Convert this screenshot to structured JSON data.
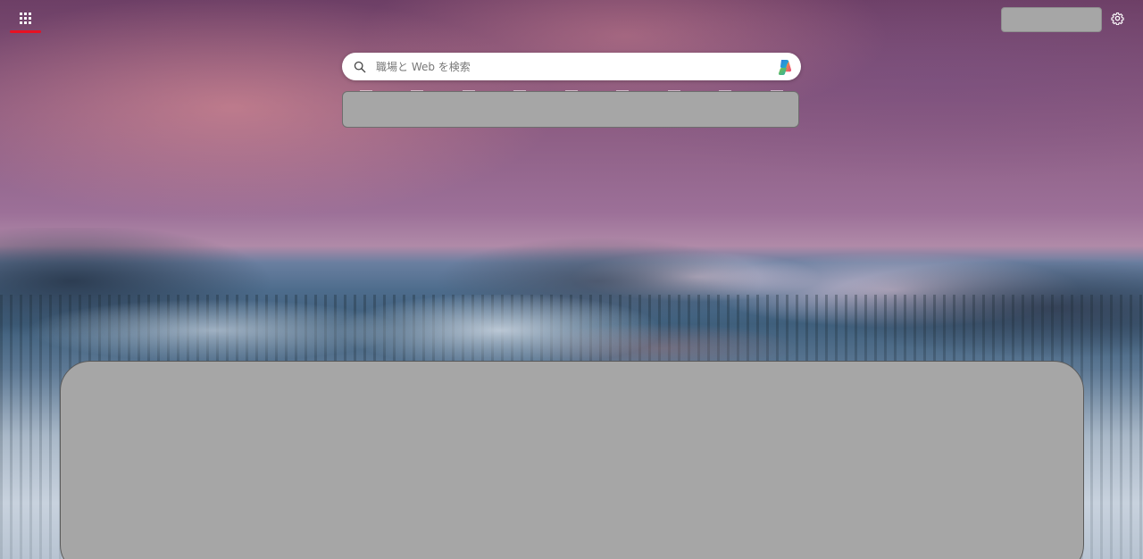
{
  "header": {
    "apps_icon": "app-launcher-grid-icon",
    "settings_icon": "gear-icon",
    "accent_color": "#e81123"
  },
  "search": {
    "placeholder": "職場と Web を検索",
    "search_icon": "magnifier-icon",
    "copilot_icon": "copilot-icon"
  },
  "colors": {
    "placeholder_box": "#a6a6a6",
    "search_bg": "#ffffff"
  }
}
